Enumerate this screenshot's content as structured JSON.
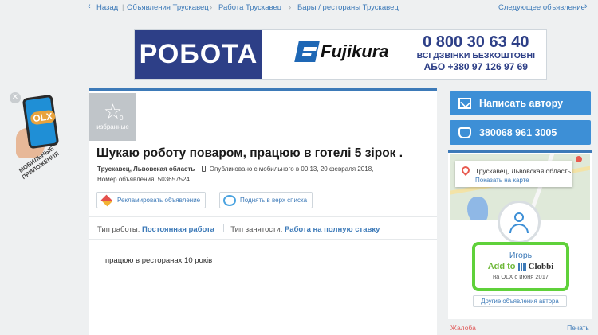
{
  "breadcrumb": {
    "back": "Назад",
    "items": [
      "Объявления Трускавец",
      "Работа Трускавец",
      "Бары / рестораны Трускавец"
    ],
    "next": "Следующее объявление"
  },
  "banner": {
    "left_text": "РОБОТА",
    "brand": "Fujikura",
    "phone": "0 800 30 63 40",
    "free_calls": "ВСІ ДЗВІНКИ БЕЗКОШТОВНІ",
    "alt_phone": "АБО +380 97 126 97 69"
  },
  "promo": {
    "close": "✕",
    "logo": "OLX",
    "caption": "МОБИЛЬНЫЕ ПРИЛОЖЕНИЯ"
  },
  "ad": {
    "favorites_count": "0",
    "favorites_label": "избранные",
    "title": "Шукаю роботу поваром, працюю в готелі 5 зірок .",
    "location": "Трускавец, Львовская область",
    "published": "Опубликовано с мобильного",
    "published_at": "в 00:13, 20 февраля 2018,",
    "ad_number": "Номер объявления: 503657524",
    "promote_button": "Рекламировать объявление",
    "raise_button": "Поднять в верх списка",
    "work_type_label": "Тип работы:",
    "work_type_value": "Постоянная работа",
    "employment_label": "Тип занятости:",
    "employment_value": "Работа на полную ставку",
    "description": "працюю в ресторанах 10 років"
  },
  "sidebar": {
    "message_button": "Написать автору",
    "phone_button": "380068 961 3005",
    "map_city": "Трускавец, Львовская область",
    "map_link": "Показать на карте",
    "user_name": "Игорь",
    "add_to": "Add to",
    "clobbi": "Clobbi",
    "member_since": "на OLX с июня 2017",
    "other_ads": "Другие объявления автора",
    "complaint": "Жалоба",
    "print": "Печать"
  },
  "colors": {
    "accent": "#3d8fd6",
    "link": "#3d7ab8",
    "banner_blue": "#2d3f87",
    "highlight_green": "#5fd13a"
  }
}
